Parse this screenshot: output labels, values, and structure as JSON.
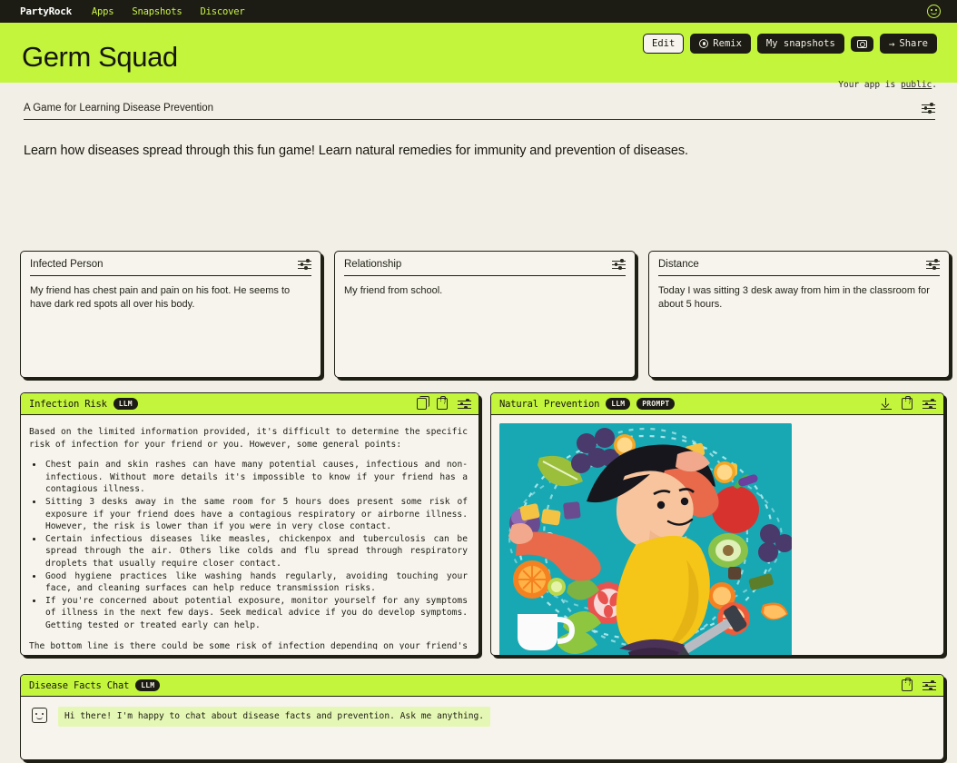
{
  "nav": {
    "brand": "PartyRock",
    "links": [
      "Apps",
      "Snapshots",
      "Discover"
    ],
    "profile_icon": "smiley-face-icon"
  },
  "hero": {
    "title": "Germ Squad",
    "buttons": [
      {
        "label": "Edit",
        "icon": null
      },
      {
        "label": "Remix",
        "icon": "remix-circle-icon"
      },
      {
        "label": "My snapshots",
        "icon": null
      },
      {
        "label": "",
        "icon": "camera-icon"
      },
      {
        "label": "Share",
        "icon": "arrow-right-icon"
      }
    ],
    "visibility_prefix": "Your app is ",
    "visibility_value": "public",
    "visibility_suffix": ".",
    "bg_color": "#c3f53c"
  },
  "description": {
    "label": "A Game for Learning Disease Prevention",
    "settings_icon": "sliders-icon",
    "tagline": "Learn how diseases spread through this fun game! Learn natural remedies for immunity and prevention of diseases."
  },
  "input_cards": [
    {
      "title": "Infected Person",
      "value": "My friend has chest pain and pain on his foot. He seems to have dark red spots all over his body.",
      "settings_icon": "sliders-icon"
    },
    {
      "title": "Relationship",
      "value": "My friend from school.",
      "settings_icon": "sliders-icon"
    },
    {
      "title": "Distance",
      "value": "Today I was sitting 3 desk away from him in the classroom for about 5 hours.",
      "settings_icon": "sliders-icon"
    }
  ],
  "infection_risk": {
    "title": "Infection Risk",
    "badges": [
      "LLM"
    ],
    "icons": [
      "copy-icon",
      "snapshot-icon",
      "sliders-icon"
    ],
    "intro": "Based on the limited information provided, it's difficult to determine the specific risk of infection for your friend or you. However, some general points:",
    "bullets": [
      "Chest pain and skin rashes can have many potential causes, infectious and non-infectious. Without more details it's impossible to know if your friend has a contagious illness.",
      "Sitting 3 desks away in the same room for 5 hours does present some risk of exposure if your friend does have a contagious respiratory or airborne illness. However, the risk is lower than if you were in very close contact.",
      "Certain infectious diseases like measles, chickenpox and tuberculosis can be spread through the air. Others like colds and flu spread through respiratory droplets that usually require closer contact.",
      "Good hygiene practices like washing hands regularly, avoiding touching your face, and cleaning surfaces can help reduce transmission risks.",
      "If you're concerned about potential exposure, monitor yourself for any symptoms of illness in the next few days. Seek medical advice if you do develop symptoms. Getting tested or treated early can help."
    ],
    "closing": "The bottom line is there could be some risk of infection depending on your friend's illness."
  },
  "natural_prevention": {
    "title": "Natural Prevention",
    "badges": [
      "LLM",
      "PROMPT"
    ],
    "icons": [
      "download-icon",
      "snapshot-icon",
      "sliders-icon"
    ],
    "image_alt": "Illustration of a smiling woman stretching surrounded by fruits, vegetables and dumbbells on a teal background",
    "image_bg": "#1aa9b4"
  },
  "disease_facts_chat": {
    "title": "Disease Facts Chat",
    "badges": [
      "LLM"
    ],
    "icons": [
      "snapshot-icon",
      "sliders-icon"
    ],
    "avatar_icon": "smiley-face-icon",
    "message": "Hi there! I'm happy to chat about disease facts and prevention. Ask me anything."
  },
  "colors": {
    "accent": "#c3f53c",
    "page_bg": "#f2efe6",
    "card_bg": "#f6f4ec",
    "ink": "#1f1f16",
    "nav_bg": "#1c1c14",
    "chat_bubble": "#e5f7b4"
  }
}
